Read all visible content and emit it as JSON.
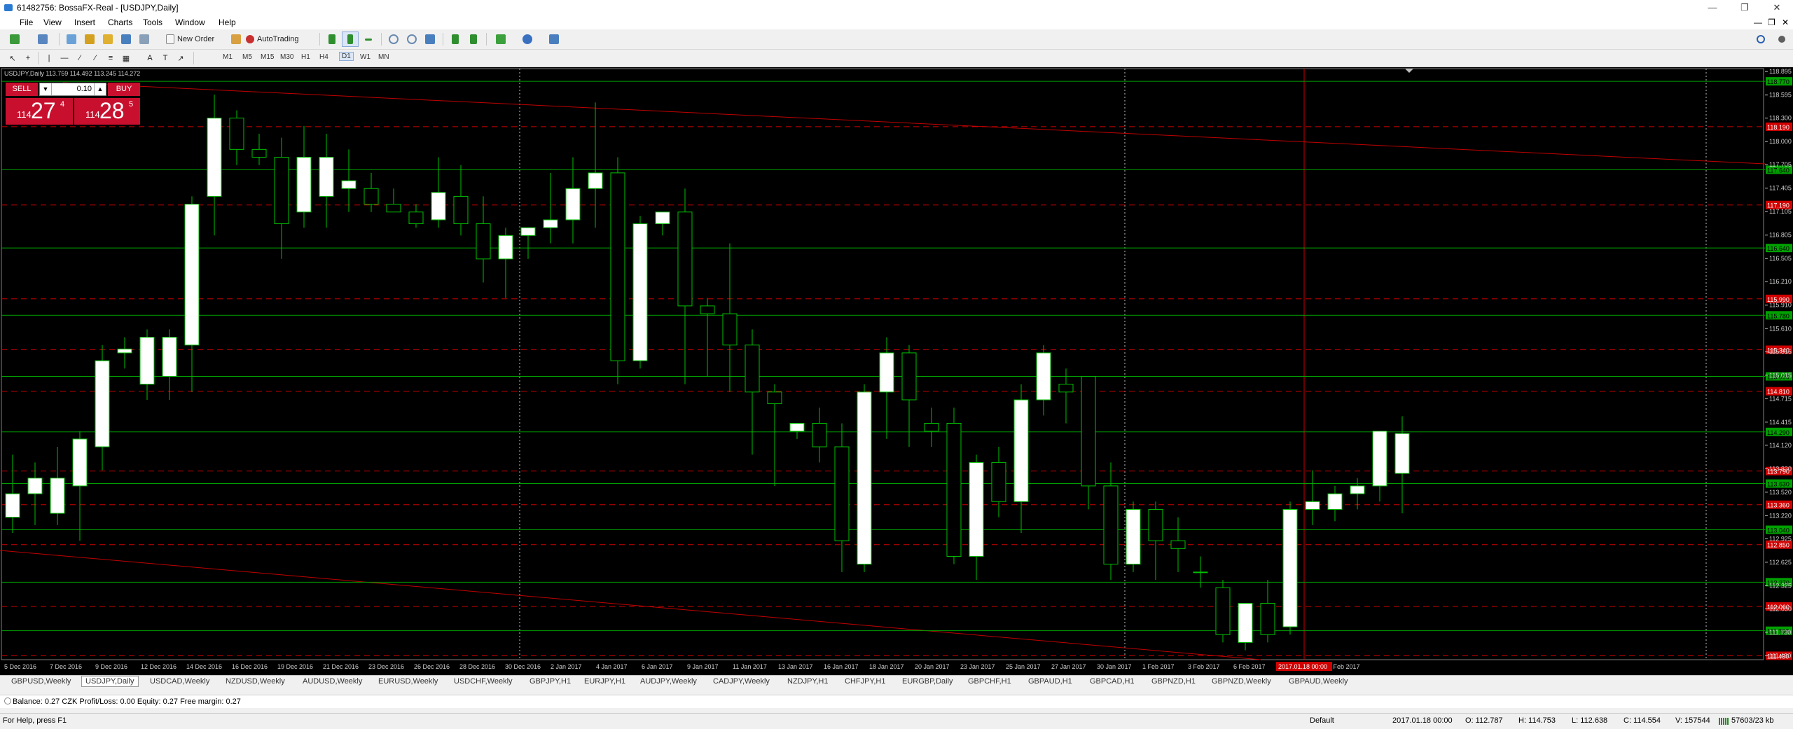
{
  "window": {
    "title": "61482756: BossaFX-Real - [USDJPY,Daily]"
  },
  "menu": [
    "File",
    "View",
    "Insert",
    "Charts",
    "Tools",
    "Window",
    "Help"
  ],
  "toolbar": {
    "new_order": "New Order",
    "autotrading": "AutoTrading"
  },
  "timeframes": [
    "M1",
    "M5",
    "M15",
    "M30",
    "H1",
    "H4",
    "D1",
    "W1",
    "MN"
  ],
  "chart": {
    "header": "USDJPY,Daily  113.759 114.492 113.245 114.272",
    "sell_label": "SELL",
    "buy_label": "BUY",
    "lot": "0.10",
    "sell_price": {
      "small": "114",
      "big": "27",
      "sup": "4"
    },
    "buy_price": {
      "small": "114",
      "big": "28",
      "sup": "5"
    },
    "price_ticks": [
      "118.895",
      "118.595",
      "118.300",
      "118.000",
      "117.705",
      "117.405",
      "117.105",
      "116.805",
      "116.505",
      "116.210",
      "115.910",
      "115.610",
      "115.315",
      "115.015",
      "114.715",
      "114.415",
      "114.120",
      "113.820",
      "113.520",
      "113.220",
      "112.925",
      "112.625",
      "112.325",
      "112.030",
      "111.730",
      "111.430"
    ],
    "date_labels": [
      "5 Dec 2016",
      "7 Dec 2016",
      "9 Dec 2016",
      "12 Dec 2016",
      "14 Dec 2016",
      "16 Dec 2016",
      "19 Dec 2016",
      "21 Dec 2016",
      "23 Dec 2016",
      "26 Dec 2016",
      "28 Dec 2016",
      "30 Dec 2016",
      "2 Jan 2017",
      "4 Jan 2017",
      "6 Jan 2017",
      "9 Jan 2017",
      "11 Jan 2017",
      "13 Jan 2017",
      "16 Jan 2017",
      "18 Jan 2017",
      "20 Jan 2017",
      "23 Jan 2017",
      "25 Jan 2017",
      "27 Jan 2017",
      "30 Jan 2017",
      "1 Feb 2017",
      "3 Feb 2017",
      "6 Feb 2017",
      "8 Feb 2017",
      "13 Feb 2017"
    ],
    "green_levels": [
      {
        "price": 118.77,
        "label": "118.770"
      },
      {
        "price": 117.64,
        "label": "117.640"
      },
      {
        "price": 116.64,
        "label": "116.640"
      },
      {
        "price": 115.78,
        "label": "115.780"
      },
      {
        "price": 115.0,
        "label": "115.000"
      },
      {
        "price": 114.29,
        "label": "114.290"
      },
      {
        "price": 113.63,
        "label": "113.630"
      },
      {
        "price": 113.04,
        "label": "113.040"
      },
      {
        "price": 112.37,
        "label": "112.370"
      },
      {
        "price": 111.75,
        "label": "111.750"
      }
    ],
    "red_levels": [
      {
        "price": 118.19,
        "label": "118.190"
      },
      {
        "price": 117.19,
        "label": "117.190"
      },
      {
        "price": 115.99,
        "label": "115.990"
      },
      {
        "price": 115.34,
        "label": "115.340"
      },
      {
        "price": 114.81,
        "label": "114.810"
      },
      {
        "price": 113.79,
        "label": "113.790"
      },
      {
        "price": 113.36,
        "label": "113.360"
      },
      {
        "price": 112.85,
        "label": "112.850"
      },
      {
        "price": 112.06,
        "label": "112.060"
      },
      {
        "price": 111.43,
        "label": "111.430"
      }
    ],
    "crosshair_label": "2017.01.18 00:00",
    "candles": [
      [
        113.2,
        114.0,
        113.0,
        113.5
      ],
      [
        113.5,
        113.9,
        113.1,
        113.7
      ],
      [
        113.25,
        114.1,
        113.1,
        113.7
      ],
      [
        113.6,
        114.3,
        112.9,
        114.2
      ],
      [
        114.1,
        115.4,
        113.8,
        115.2
      ],
      [
        115.3,
        115.5,
        115.1,
        115.35
      ],
      [
        114.9,
        115.6,
        114.7,
        115.5
      ],
      [
        115.0,
        115.6,
        114.7,
        115.5
      ],
      [
        115.4,
        117.3,
        114.8,
        117.2
      ],
      [
        117.3,
        118.6,
        116.8,
        118.3
      ],
      [
        118.3,
        118.4,
        117.7,
        117.9
      ],
      [
        117.9,
        118.1,
        117.7,
        117.8
      ],
      [
        117.8,
        118.05,
        116.5,
        116.95
      ],
      [
        117.1,
        118.2,
        116.9,
        117.8
      ],
      [
        117.3,
        118.1,
        116.9,
        117.8
      ],
      [
        117.4,
        117.9,
        117.1,
        117.5
      ],
      [
        117.4,
        117.6,
        117.1,
        117.2
      ],
      [
        117.2,
        117.4,
        117.1,
        117.1
      ],
      [
        117.1,
        117.2,
        116.9,
        116.95
      ],
      [
        117.0,
        117.8,
        116.9,
        117.35
      ],
      [
        117.3,
        117.7,
        116.8,
        116.95
      ],
      [
        116.95,
        117.3,
        116.2,
        116.5
      ],
      [
        116.5,
        116.9,
        116.0,
        116.8
      ],
      [
        116.8,
        116.9,
        116.5,
        116.9
      ],
      [
        116.9,
        117.6,
        116.7,
        117.0
      ],
      [
        117.0,
        117.8,
        116.7,
        117.4
      ],
      [
        117.4,
        118.5,
        116.9,
        117.6
      ],
      [
        117.6,
        117.8,
        114.9,
        115.2
      ],
      [
        115.2,
        117.05,
        115.1,
        116.95
      ],
      [
        116.95,
        117.1,
        116.8,
        117.1
      ],
      [
        117.1,
        117.4,
        114.9,
        115.9
      ],
      [
        115.9,
        116.0,
        115.0,
        115.8
      ],
      [
        115.8,
        116.7,
        114.8,
        115.4
      ],
      [
        115.4,
        115.6,
        114.0,
        114.8
      ],
      [
        114.8,
        114.9,
        113.6,
        114.65
      ],
      [
        114.3,
        114.4,
        114.2,
        114.4
      ],
      [
        114.4,
        114.6,
        113.9,
        114.1
      ],
      [
        114.1,
        114.4,
        112.5,
        112.9
      ],
      [
        112.6,
        114.9,
        112.5,
        114.8
      ],
      [
        114.8,
        115.5,
        114.2,
        115.3
      ],
      [
        115.3,
        115.4,
        114.1,
        114.7
      ],
      [
        114.4,
        114.6,
        114.1,
        114.3
      ],
      [
        114.4,
        114.6,
        112.6,
        112.7
      ],
      [
        112.7,
        114.0,
        112.4,
        113.9
      ],
      [
        113.9,
        114.1,
        113.2,
        113.4
      ],
      [
        113.4,
        114.9,
        113.0,
        114.7
      ],
      [
        114.7,
        115.4,
        114.5,
        115.3
      ],
      [
        114.9,
        115.1,
        114.4,
        114.8
      ],
      [
        115.0,
        115.0,
        113.3,
        113.6
      ],
      [
        113.6,
        113.9,
        112.4,
        112.6
      ],
      [
        112.6,
        113.4,
        112.5,
        113.3
      ],
      [
        113.3,
        113.4,
        112.4,
        112.9
      ],
      [
        112.9,
        113.2,
        112.5,
        112.8
      ],
      [
        112.5,
        112.7,
        112.3,
        112.5
      ],
      [
        112.3,
        112.4,
        111.6,
        111.7
      ],
      [
        111.6,
        112.1,
        111.5,
        112.1
      ],
      [
        112.1,
        112.4,
        111.6,
        111.7
      ],
      [
        111.8,
        113.4,
        111.7,
        113.3
      ],
      [
        113.3,
        113.8,
        113.1,
        113.4
      ],
      [
        113.3,
        113.6,
        113.15,
        113.5
      ],
      [
        113.5,
        113.7,
        113.3,
        113.6
      ],
      [
        113.6,
        114.2,
        113.4,
        114.3
      ],
      [
        113.76,
        114.49,
        113.25,
        114.27
      ]
    ]
  },
  "tabs": [
    "GBPUSD,Weekly",
    "USDJPY,Daily",
    "USDCAD,Weekly",
    "NZDUSD,Weekly",
    "AUDUSD,Weekly",
    "EURUSD,Weekly",
    "USDCHF,Weekly",
    "GBPJPY,H1",
    "EURJPY,H1",
    "AUDJPY,Weekly",
    "CADJPY,Weekly",
    "NZDJPY,H1",
    "CHFJPY,H1",
    "EURGBP,Daily",
    "GBPCHF,H1",
    "GBPAUD,H1",
    "GBPCAD,H1",
    "GBPNZD,H1",
    "GBPNZD,Weekly",
    "GBPAUD,Weekly"
  ],
  "terminal": {
    "balance": "Balance: 0.27 CZK  Profit/Loss: 0.00  Equity: 0.27  Free margin: 0.27"
  },
  "status": {
    "help": "For Help, press F1",
    "profile": "Default",
    "datetime": "2017.01.18 00:00",
    "open": "O: 112.787",
    "high": "H: 114.753",
    "low": "L: 112.638",
    "close": "C: 114.554",
    "volume": "V: 157544",
    "traffic": "57603/23 kb"
  },
  "colors": {
    "bull_body": "#ffffff",
    "bear_body": "#000000",
    "candle_line": "#00c000",
    "green_level": "#00a000",
    "red_level": "#d00000",
    "trendline": "#c00000"
  }
}
